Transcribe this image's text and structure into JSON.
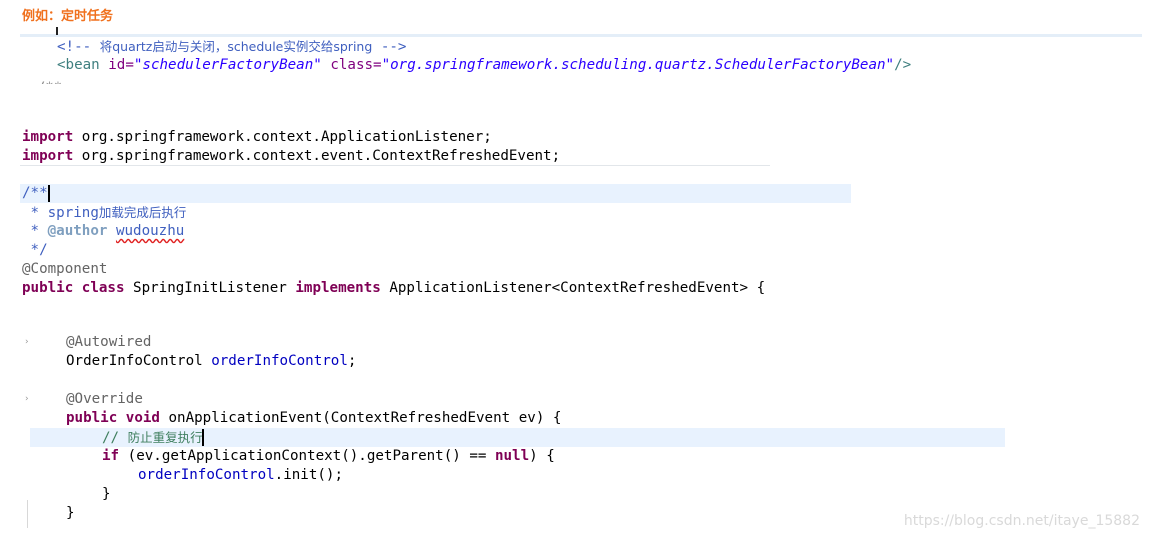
{
  "heading": "例如：定时任务",
  "xml": {
    "comment_open": "<!-- ",
    "comment_text": "将quartz启动与关闭，schedule实例交给spring",
    "comment_close": " -->",
    "bean_open": "<bean ",
    "id_attr": "id=",
    "id_value": "\"schedulerFactoryBean\"",
    "class_attr": "class=",
    "class_value": "\"org.springframework.scheduling.quartz.SchedulerFactoryBean\"",
    "bean_close": "/>"
  },
  "code": {
    "import_kw": "import",
    "import_1": " org.springframework.context.ApplicationListener;",
    "import_2": " org.springframework.context.event.ContextRefreshedEvent;",
    "javadoc_open": "/**",
    "javadoc_line1_prefix": " * spring",
    "javadoc_line1_cjk": "加载完成后执行",
    "javadoc_author_prefix": " * ",
    "javadoc_author_tag": "@author",
    "javadoc_author_name": "wudouzhu",
    "javadoc_close": " */",
    "component_anno": "@Component",
    "kw_public": "public",
    "kw_class": "class",
    "class_name": " SpringInitListener ",
    "kw_implements": "implements",
    "class_rest": " ApplicationListener<ContextRefreshedEvent> {",
    "autowired_anno": "@Autowired",
    "field_type": "OrderInfoControl ",
    "field_name": "orderInfoControl",
    "semicolon": ";",
    "override_anno": "@Override",
    "kw_void": "void",
    "method_sig_a": " onApplicationEvent(ContextRefreshedEvent ",
    "param_name": "ev",
    "method_sig_b": ") {",
    "comment_prefix": "// ",
    "comment_cjk": "防止重复执行",
    "kw_if": "if",
    "if_cond_a": " (",
    "if_cond_b": ".getApplicationContext().getParent() == ",
    "kw_null": "null",
    "if_cond_c": ") {",
    "call_rest": ".init();",
    "brace_inner": "}",
    "brace_method": "}"
  },
  "watermark": "https://blog.csdn.net/itaye_15882"
}
